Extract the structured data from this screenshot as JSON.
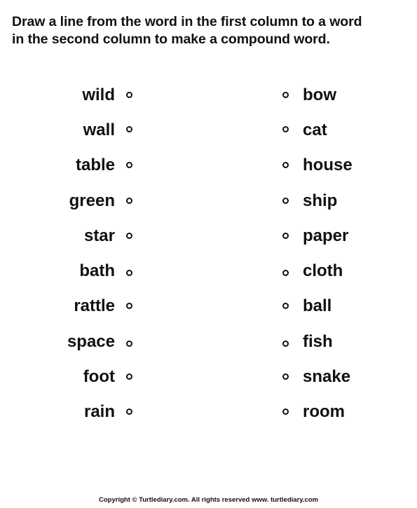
{
  "instructions": {
    "line1": "Draw a line from the word in the first column to a word",
    "line2": "in the second column to make a compound word."
  },
  "left_column": [
    "wild",
    "wall",
    "table",
    "green",
    "star",
    "bath",
    "rattle",
    "space",
    "foot",
    "rain"
  ],
  "right_column": [
    "bow",
    "cat",
    "house",
    "ship",
    "paper",
    "cloth",
    "ball",
    "fish",
    "snake",
    "room"
  ],
  "footer": "Copyright © Turtlediary.com. All rights reserved   www. turtlediary.com"
}
